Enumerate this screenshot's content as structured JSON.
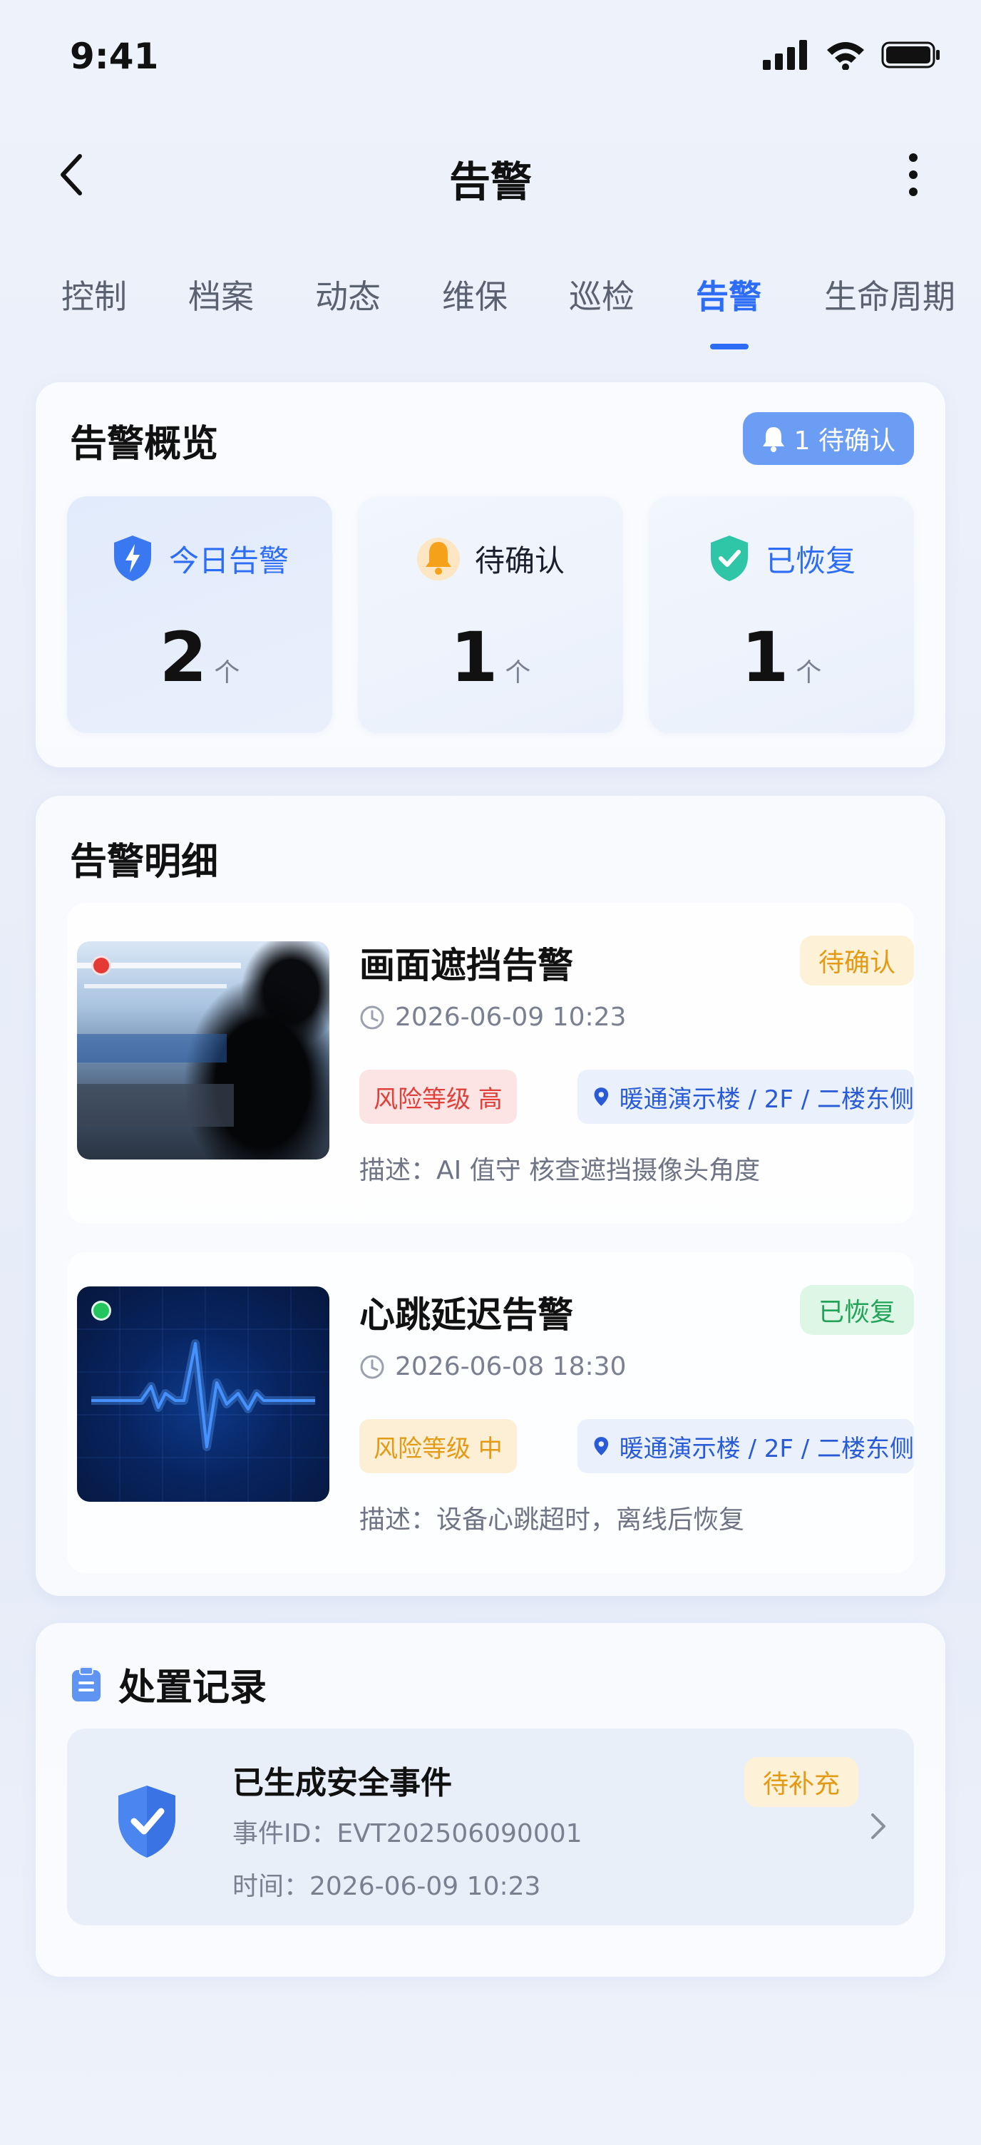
{
  "status_bar": {
    "time": "9:41"
  },
  "nav": {
    "title": "告警"
  },
  "tabs": [
    {
      "label": "控制"
    },
    {
      "label": "档案"
    },
    {
      "label": "动态"
    },
    {
      "label": "维保"
    },
    {
      "label": "巡检"
    },
    {
      "label": "告警",
      "active": true
    },
    {
      "label": "生命周期"
    }
  ],
  "overview": {
    "title": "告警概览",
    "pending_pill": "1 待确认",
    "stats": [
      {
        "label": "今日告警",
        "value": "2",
        "unit": "个",
        "icon": "shield-bolt-icon",
        "color": "#2d6df6"
      },
      {
        "label": "待确认",
        "value": "1",
        "unit": "个",
        "icon": "bell-icon",
        "color": "#1a1f2e"
      },
      {
        "label": "已恢复",
        "value": "1",
        "unit": "个",
        "icon": "shield-check-icon",
        "color": "#2d6df6"
      }
    ]
  },
  "details": {
    "title": "告警明细",
    "items": [
      {
        "title": "画面遮挡告警",
        "status": "待确认",
        "time": "2026-06-09 10:23",
        "risk": "风险等级  高",
        "location": "暖通演示楼 / 2F / 二楼东侧",
        "description": "描述：AI 值守 核查遮挡摄像头角度",
        "thumb_icon": "camera-occlusion-image",
        "dot_color": "#e53935"
      },
      {
        "title": "心跳延迟告警",
        "status": "已恢复",
        "time": "2026-06-08 18:30",
        "risk": "风险等级  中",
        "location": "暖通演示楼 / 2F / 二楼东侧",
        "description": "描述：设备心跳超时，离线后恢复",
        "thumb_icon": "heartbeat-waveform-image",
        "dot_color": "#22c55e"
      }
    ]
  },
  "records": {
    "title": "处置记录",
    "item": {
      "name": "已生成安全事件",
      "badge": "待补充",
      "event_id": "事件ID：EVT202506090001",
      "time": "时间：2026-06-09 10:23"
    }
  },
  "colors": {
    "accent": "#2d6df6",
    "pending": "#e39a14",
    "recovered": "#22a35a",
    "risk_high": "#e0403a",
    "risk_mid": "#e39a14"
  }
}
